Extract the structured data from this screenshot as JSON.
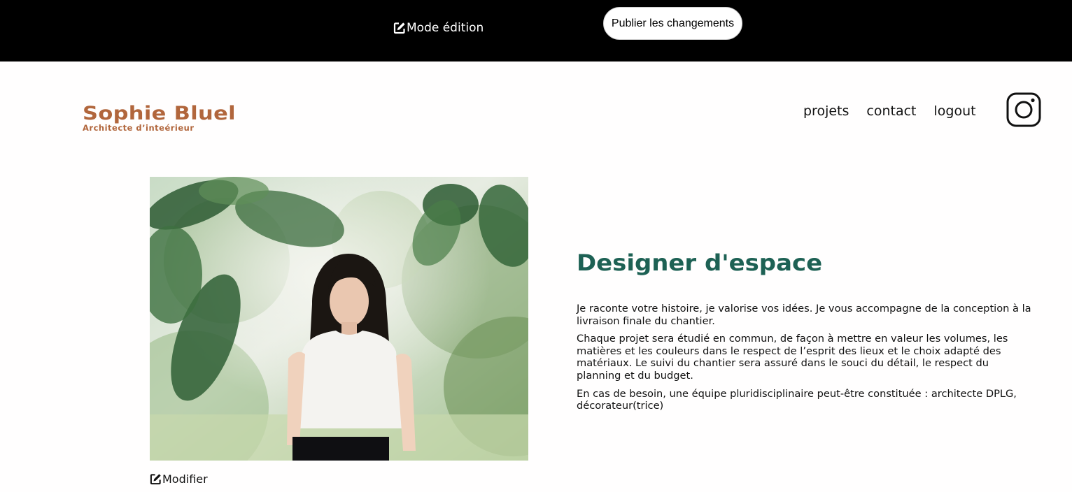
{
  "edition_bar": {
    "mode_label": "Mode édition",
    "publish_label": "Publier les changements",
    "icon": "edit-icon"
  },
  "header": {
    "title": "Sophie Bluel",
    "subtitle": "Architecte d’inteérieur",
    "nav": [
      {
        "label": "projets"
      },
      {
        "label": "contact"
      },
      {
        "label": "logout"
      }
    ],
    "social_icon": "instagram-icon"
  },
  "introduction": {
    "title": "Designer d'espace",
    "paragraphs": [
      "Je raconte votre histoire, je valorise vos idées. Je vous accompagne de la conception à la livraison finale du chantier.",
      "Chaque projet sera étudié en commun, de façon à mettre en valeur les volumes, les matières et les couleurs dans le respect de l’esprit des lieux et le choix adapté des matériaux. Le suivi du chantier sera assuré dans le souci du détail, le respect du planning et du budget.",
      "En cas de besoin, une équipe pluridisciplinaire peut-être constituée : architecte DPLG, décorateur(trice)"
    ],
    "modify_label": "Modifier",
    "photo_icon": "portrait-photo"
  },
  "colors": {
    "brand": "#b1663c",
    "title": "#1d6154",
    "bar": "#000000"
  }
}
